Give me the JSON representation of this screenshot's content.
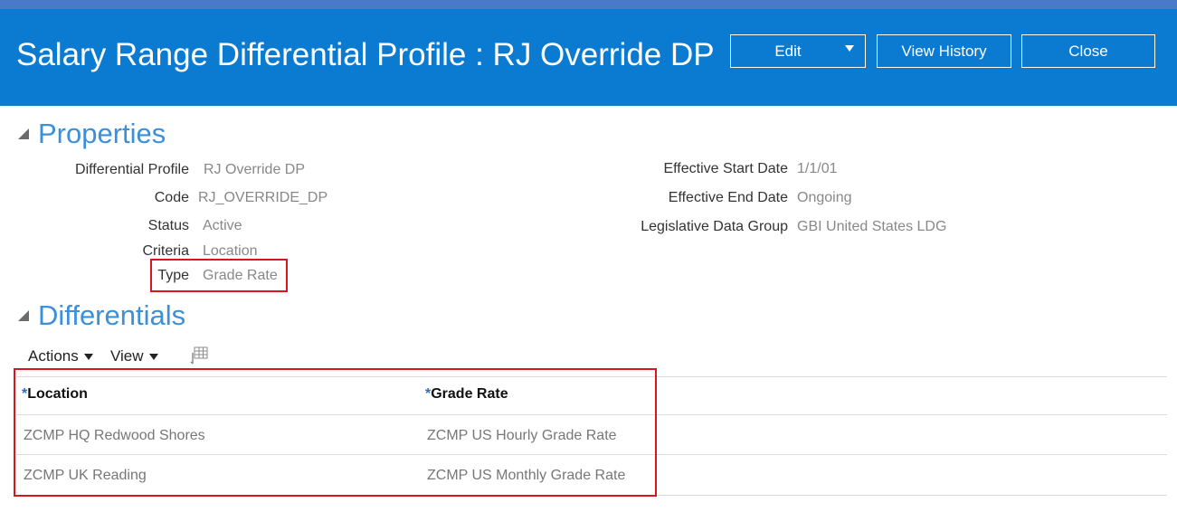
{
  "header": {
    "title": "Salary Range Differential Profile : RJ Override DP",
    "buttons": {
      "edit": "Edit",
      "view_history": "View History",
      "close": "Close"
    }
  },
  "properties": {
    "section_title": "Properties",
    "left": [
      {
        "label": "Differential Profile",
        "value": "RJ Override DP"
      },
      {
        "label": "Code",
        "value": "RJ_OVERRIDE_DP"
      },
      {
        "label": "Status",
        "value": "Active"
      },
      {
        "label": "Criteria",
        "value": "Location"
      },
      {
        "label": "Type",
        "value": "Grade Rate"
      }
    ],
    "right": [
      {
        "label": "Effective Start Date",
        "value": "1/1/01"
      },
      {
        "label": "Effective End Date",
        "value": "Ongoing"
      },
      {
        "label": "Legislative Data Group",
        "value": "GBI United States LDG"
      }
    ]
  },
  "differentials": {
    "section_title": "Differentials",
    "toolbar": {
      "actions": "Actions",
      "view": "View"
    },
    "columns": [
      {
        "required_mark": "*",
        "label": "Location"
      },
      {
        "required_mark": "*",
        "label": "Grade Rate"
      }
    ],
    "rows": [
      [
        "ZCMP HQ Redwood Shores",
        "ZCMP US Hourly Grade Rate"
      ],
      [
        "ZCMP UK Reading",
        "ZCMP US Monthly Grade Rate"
      ]
    ]
  },
  "colors": {
    "header_bg": "#0a7bd1",
    "accent": "#3c8fd9",
    "highlight": "#d9161d"
  }
}
